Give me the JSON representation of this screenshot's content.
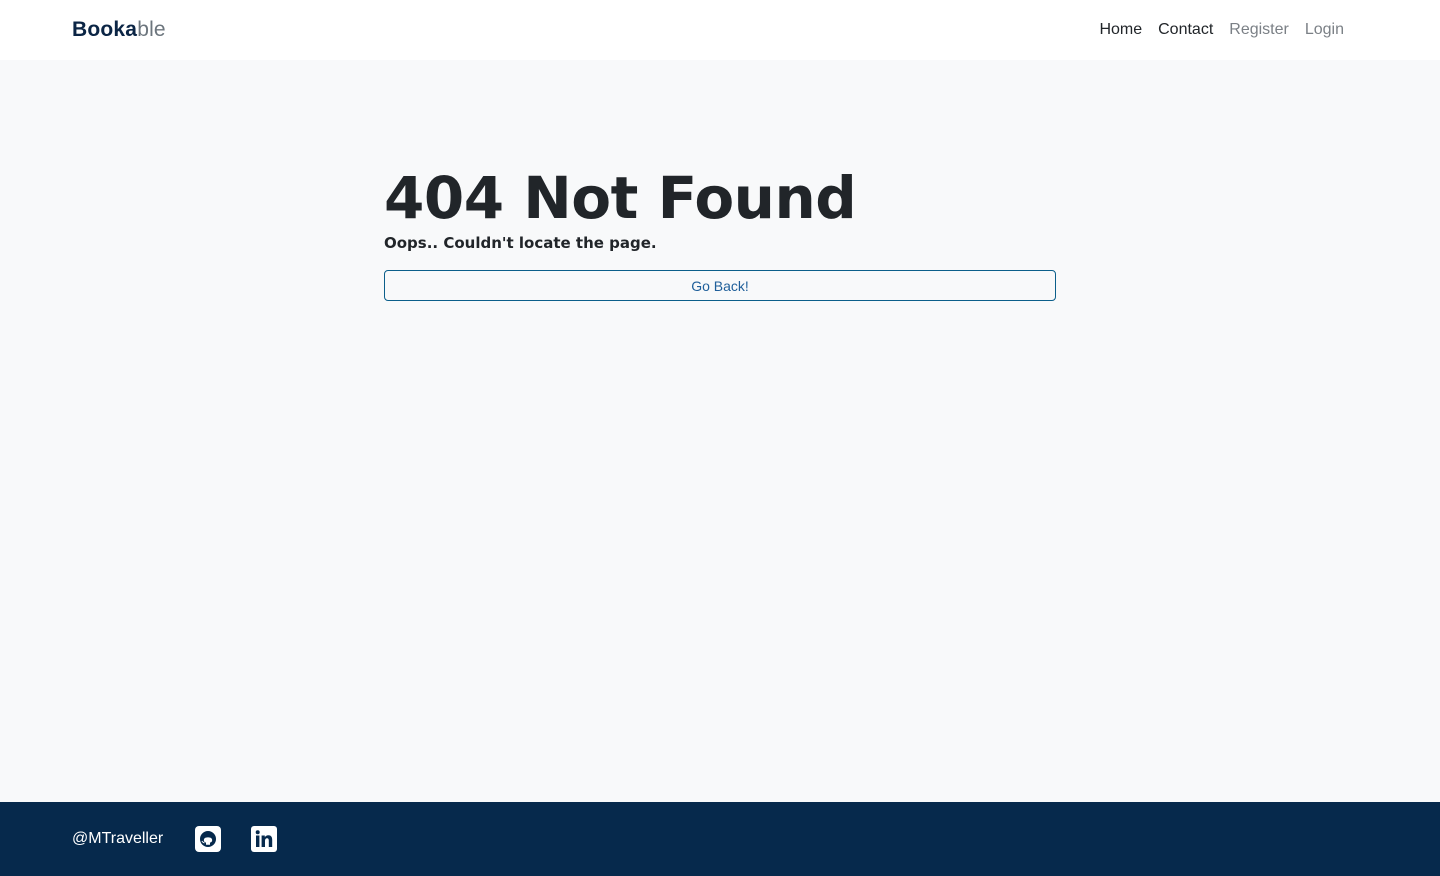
{
  "header": {
    "brand_bold": "Booka",
    "brand_light": "ble",
    "nav": {
      "home": "Home",
      "contact": "Contact",
      "register": "Register",
      "login": "Login"
    }
  },
  "main": {
    "title": "404 Not Found",
    "subtitle": "Oops.. Couldn't locate the page.",
    "back_button": "Go Back!"
  },
  "footer": {
    "handle": "@MTraveller",
    "icons": [
      "github-icon",
      "linkedin-icon"
    ]
  },
  "colors": {
    "navy": "#06294c",
    "button_border": "#0b5e8a",
    "background": "#f8f9fa"
  }
}
